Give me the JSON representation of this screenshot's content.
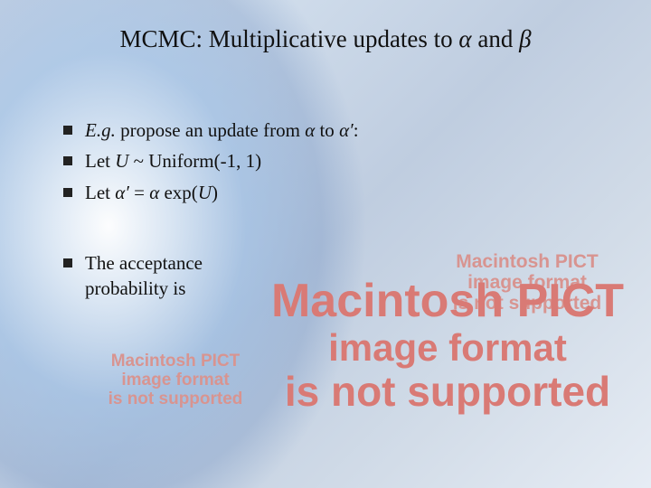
{
  "title": {
    "pre": "MCMC: Multiplicative updates to ",
    "alpha": "α",
    "mid": " and ",
    "beta": "β"
  },
  "bullets": {
    "b1": {
      "eg": "E.g.",
      "t1": " propose an update from ",
      "a1": "α",
      "t2": " to ",
      "a2": "α′",
      "t3": ":"
    },
    "b2": {
      "t1": "Let ",
      "u": "U",
      "t2": " ~ Uniform(-1, 1)"
    },
    "b3": {
      "t1": "Let ",
      "a1": "α′",
      "t2": " = ",
      "a2": "α",
      "t3": " exp(",
      "u": "U",
      "t4": ")"
    },
    "b4": {
      "t1": "The acceptance",
      "t2": "probability is"
    }
  },
  "pict": {
    "l1": "Macintosh PICT",
    "l2": "image format",
    "l3": "is not supported"
  }
}
